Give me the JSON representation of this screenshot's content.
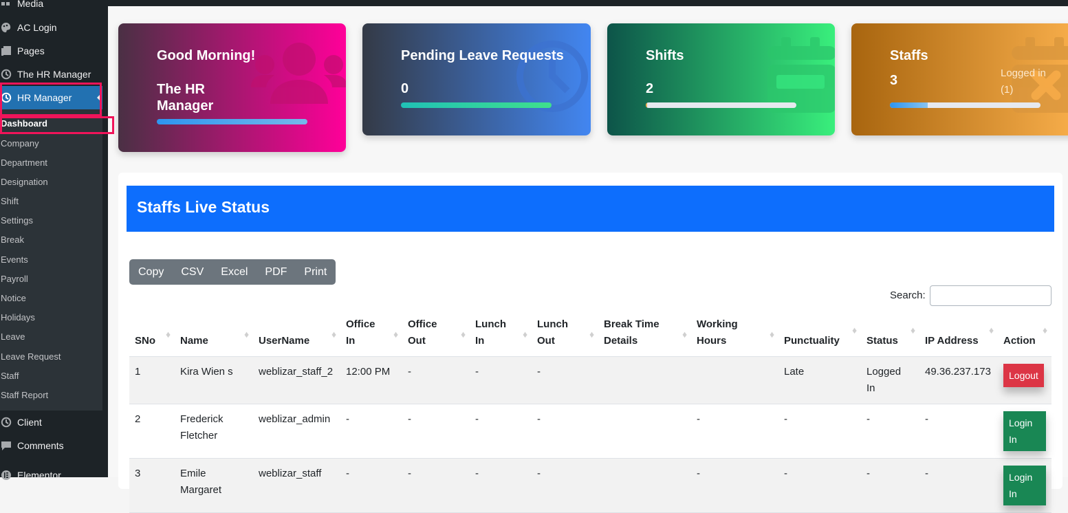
{
  "sidebar": {
    "top_items": [
      {
        "label": "Media",
        "icon": "media-icon"
      },
      {
        "label": "AC Login",
        "icon": "palette-icon"
      },
      {
        "label": "Pages",
        "icon": "pages-icon"
      },
      {
        "label": "The HR Manager",
        "icon": "clock-icon"
      },
      {
        "label": "HR Manager",
        "icon": "clock-icon",
        "active": true
      }
    ],
    "submenu": [
      {
        "label": "Dashboard",
        "current": true
      },
      {
        "label": "Company"
      },
      {
        "label": "Department"
      },
      {
        "label": "Designation"
      },
      {
        "label": "Shift"
      },
      {
        "label": "Settings"
      },
      {
        "label": "Break"
      },
      {
        "label": "Events"
      },
      {
        "label": "Payroll"
      },
      {
        "label": "Notice"
      },
      {
        "label": "Holidays"
      },
      {
        "label": "Leave"
      },
      {
        "label": "Leave Request"
      },
      {
        "label": "Staff"
      },
      {
        "label": "Staff Report"
      }
    ],
    "bottom_items": [
      {
        "label": "Client",
        "icon": "clock-icon"
      },
      {
        "label": "Comments",
        "icon": "comment-icon"
      },
      {
        "label": "Elementor",
        "icon": "elementor-icon"
      }
    ],
    "highlight_color": "#f0145a"
  },
  "cards": [
    {
      "title": "Good Morning!",
      "value": "The HR Manager",
      "progress": 1.0,
      "icon": "users-icon"
    },
    {
      "title": "Pending Leave Requests",
      "value": "0",
      "progress": 1.0,
      "icon": "clock-icon"
    },
    {
      "title": "Shifts",
      "value": "2",
      "progress": 0.01,
      "icon": "calendar-icon"
    },
    {
      "title": "Staffs",
      "value": "3",
      "subtext": "Logged in (1)",
      "progress": 0.25,
      "icon": "calendar-x-icon"
    }
  ],
  "panel": {
    "title": "Staffs Live Status",
    "export_buttons": [
      "Copy",
      "CSV",
      "Excel",
      "PDF",
      "Print"
    ],
    "search_label": "Search:",
    "search_value": "",
    "columns": [
      "SNo",
      "Name",
      "UserName",
      "Office In",
      "Office Out",
      "Lunch In",
      "Lunch Out",
      "Break Time Details",
      "Working Hours",
      "Punctuality",
      "Status",
      "IP Address",
      "Action"
    ],
    "rows": [
      {
        "sno": "1",
        "name": "Kira Wien s",
        "username": "weblizar_staff_2",
        "office_in": "12:00 PM",
        "office_out": "-",
        "lunch_in": "-",
        "lunch_out": "-",
        "break_time": "",
        "working_hours": "",
        "punctuality": "Late",
        "status": "Logged In",
        "ip": "49.36.237.173",
        "action": "Logout"
      },
      {
        "sno": "2",
        "name": "Frederick Fletcher",
        "username": "weblizar_admin",
        "office_in": "-",
        "office_out": "-",
        "lunch_in": "-",
        "lunch_out": "-",
        "break_time": "",
        "working_hours": "-",
        "punctuality": "-",
        "status": "-",
        "ip": "-",
        "action": "Login In"
      },
      {
        "sno": "3",
        "name": "Emile Margaret",
        "username": "weblizar_staff",
        "office_in": "-",
        "office_out": "-",
        "lunch_in": "-",
        "lunch_out": "-",
        "break_time": "",
        "working_hours": "-",
        "punctuality": "-",
        "status": "-",
        "ip": "-",
        "action": "Login In"
      }
    ]
  },
  "colors": {
    "primary": "#0d6efd",
    "danger": "#dc3545",
    "success": "#198754",
    "wp_active": "#2271b1"
  }
}
